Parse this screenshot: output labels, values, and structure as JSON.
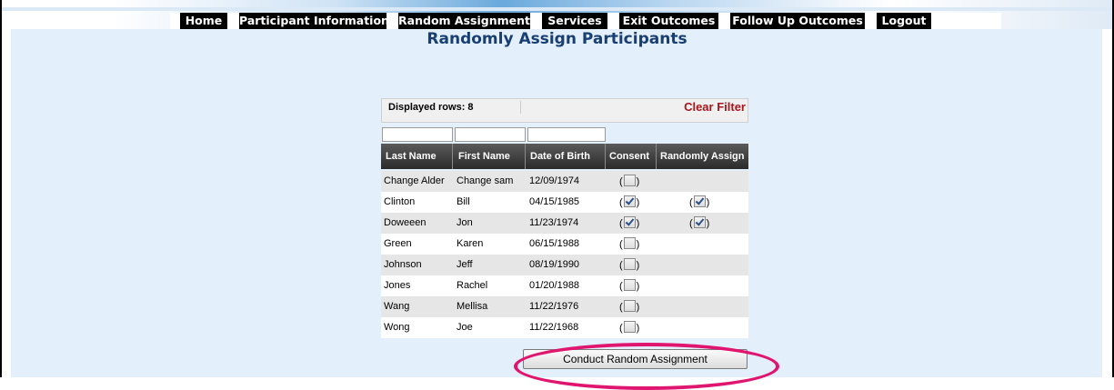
{
  "nav": {
    "items": [
      {
        "label": "Home"
      },
      {
        "label": "Participant Information"
      },
      {
        "label": "Random Assignment"
      },
      {
        "label": "Services"
      },
      {
        "label": "Exit Outcomes"
      },
      {
        "label": "Follow Up Outcomes"
      },
      {
        "label": "Logout"
      }
    ]
  },
  "page": {
    "title": "Randomly Assign Participants"
  },
  "grid": {
    "displayed_rows_label": "Displayed rows: 8",
    "clear_filter_label": "Clear Filter",
    "filters": [
      {
        "value": "",
        "placeholder": ""
      },
      {
        "value": "",
        "placeholder": ""
      },
      {
        "value": "",
        "placeholder": ""
      }
    ],
    "columns": [
      "Last Name",
      "First Name",
      "Date of Birth",
      "Consent",
      "Randomly Assign"
    ],
    "rows": [
      {
        "last": "Change Alder",
        "first": "Change sam",
        "dob": "12/09/1974",
        "consent": false,
        "assign": null
      },
      {
        "last": "Clinton",
        "first": "Bill",
        "dob": "04/15/1985",
        "consent": true,
        "assign": true
      },
      {
        "last": "Doweeen",
        "first": "Jon",
        "dob": "11/23/1974",
        "consent": true,
        "assign": true
      },
      {
        "last": "Green",
        "first": "Karen",
        "dob": "06/15/1988",
        "consent": false,
        "assign": null
      },
      {
        "last": "Johnson",
        "first": "Jeff",
        "dob": "08/19/1990",
        "consent": false,
        "assign": null
      },
      {
        "last": "Jones",
        "first": "Rachel",
        "dob": "01/20/1988",
        "consent": false,
        "assign": null
      },
      {
        "last": "Wang",
        "first": "Mellisa",
        "dob": "11/22/1976",
        "consent": false,
        "assign": null
      },
      {
        "last": "Wong",
        "first": "Joe",
        "dob": "11/22/1968",
        "consent": false,
        "assign": null
      }
    ],
    "paren_open": "(",
    "paren_close": ")"
  },
  "actions": {
    "conduct_label": "Conduct Random Assignment"
  },
  "colors": {
    "title": "#183f73",
    "clear_filter": "#a8151b",
    "highlight": "#e0156f",
    "content_bg": "#e3effb"
  },
  "icons": {
    "checkbox": "checkbox-icon"
  }
}
